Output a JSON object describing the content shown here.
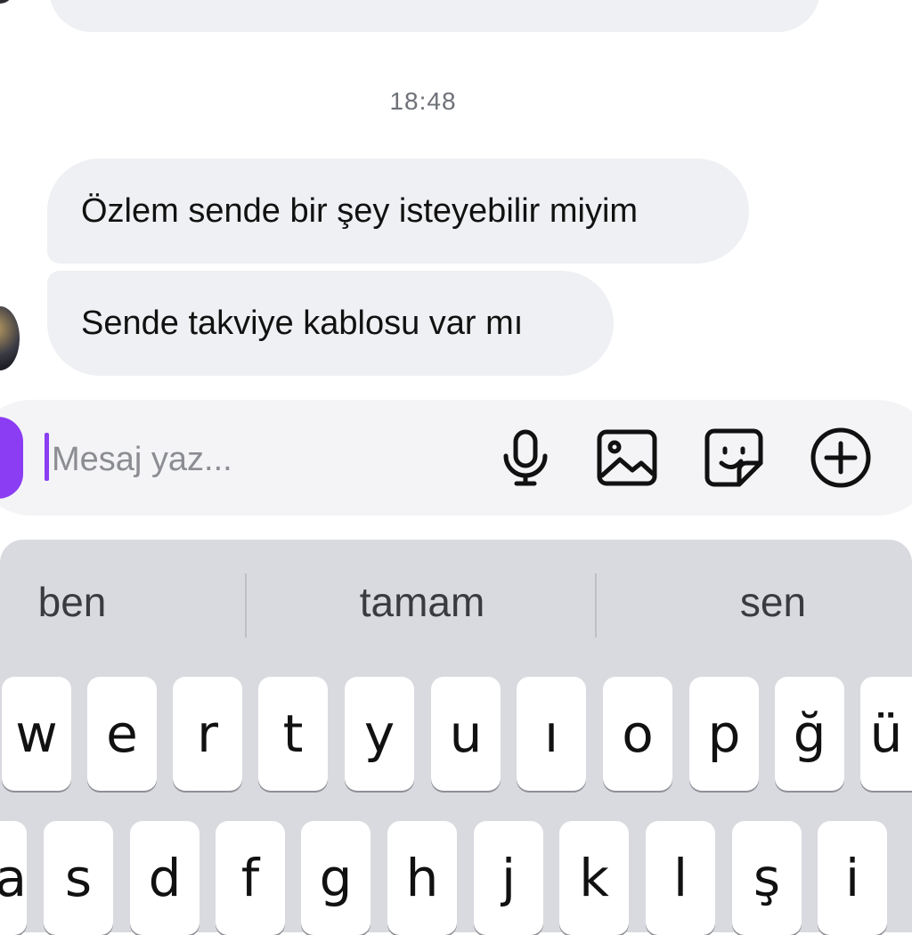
{
  "chat": {
    "previous_bubble_partial": "",
    "timestamp": "18:48",
    "messages": [
      "Özlem sende bir şey isteyebilir miyim",
      "Sende takviye kablosu var mı"
    ]
  },
  "composer": {
    "placeholder": "Mesaj yaz...",
    "icons": [
      "microphone-icon",
      "image-icon",
      "sticker-icon",
      "plus-icon"
    ],
    "accent": "#8a3df2"
  },
  "keyboard": {
    "suggestions": [
      "ben",
      "tamam",
      "sen"
    ],
    "row1": [
      "w",
      "e",
      "r",
      "t",
      "y",
      "u",
      "ı",
      "o",
      "p",
      "ğ",
      "ü"
    ],
    "row2": [
      "a",
      "s",
      "d",
      "f",
      "g",
      "h",
      "j",
      "k",
      "l",
      "ş",
      "i"
    ]
  }
}
